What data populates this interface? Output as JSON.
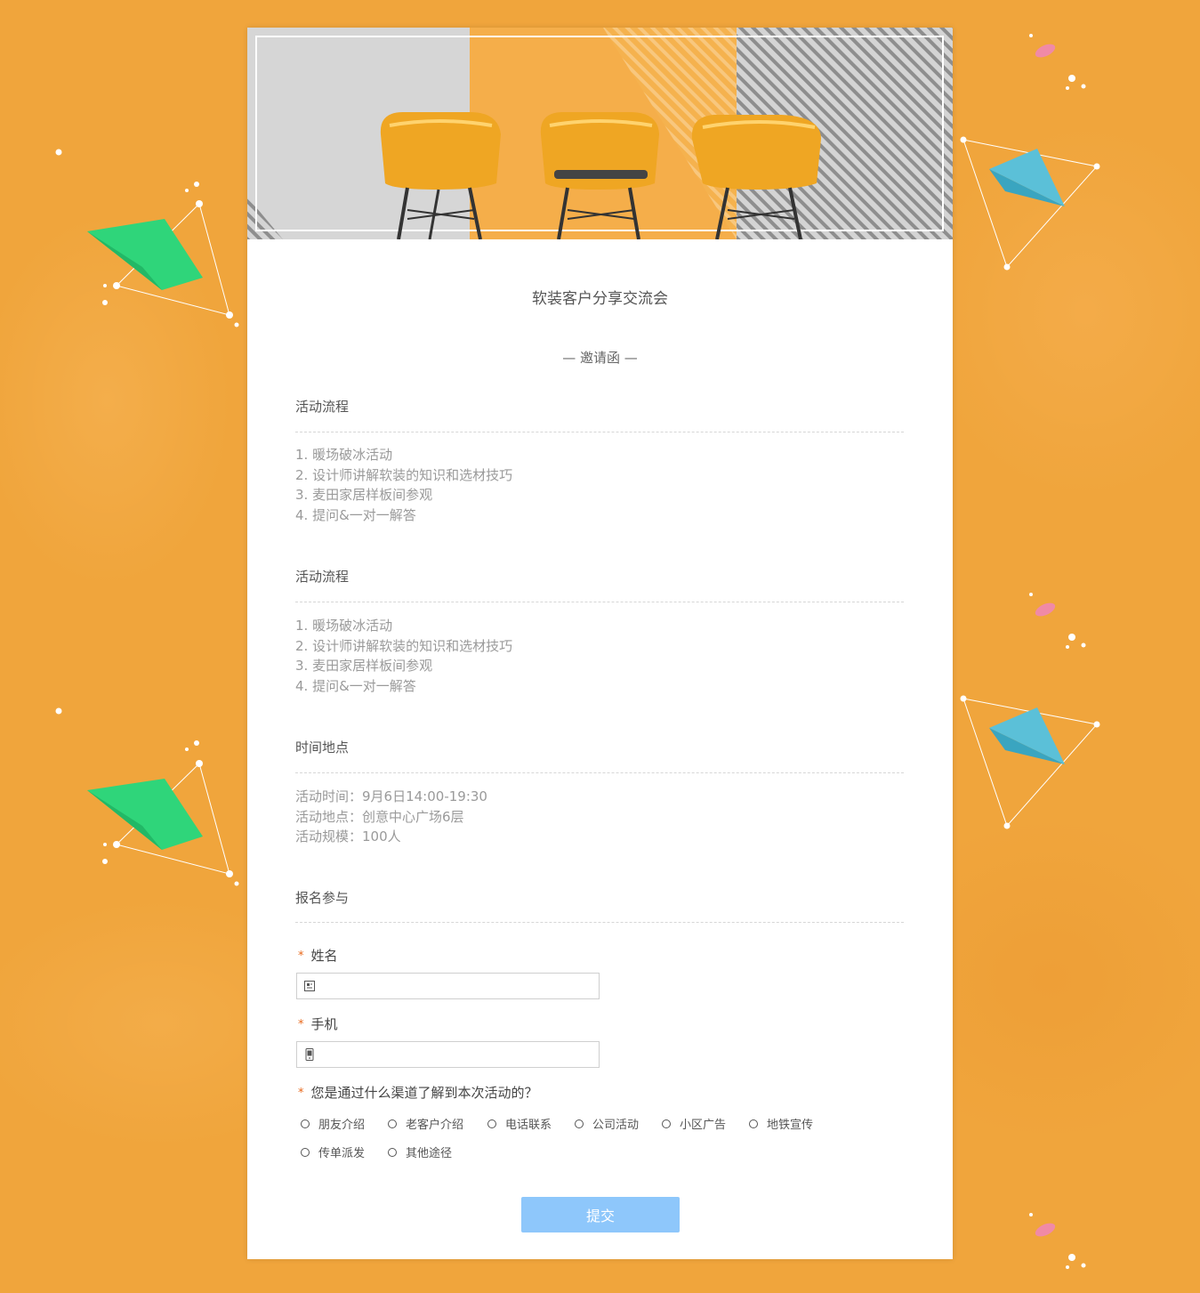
{
  "page": {
    "title": "软装客户分享交流会",
    "subtitle": "— 邀请函 —"
  },
  "sections": [
    {
      "title": "活动流程",
      "lines": [
        "1. 暖场破冰活动",
        "2. 设计师讲解软装的知识和选材技巧",
        "3. 麦田家居样板间参观",
        "4. 提问&一对一解答"
      ]
    },
    {
      "title": "活动流程",
      "lines": [
        "1. 暖场破冰活动",
        "2. 设计师讲解软装的知识和选材技巧",
        "3. 麦田家居样板间参观",
        "4. 提问&一对一解答"
      ]
    },
    {
      "title": "时间地点",
      "lines": [
        "活动时间：9月6日14:00-19:30",
        "活动地点：创意中心广场6层",
        "活动规模：100人"
      ]
    }
  ],
  "form": {
    "section_title": "报名参与",
    "required_mark": "*",
    "name_label": "姓名",
    "name_value": "",
    "phone_label": "手机",
    "phone_value": "",
    "channel_label": "您是通过什么渠道了解到本次活动的？",
    "channel_options": [
      "朋友介绍",
      "老客户介绍",
      "电话联系",
      "公司活动",
      "小区广告",
      "地铁宣传",
      "传单派发",
      "其他途径"
    ],
    "submit_label": "提交"
  },
  "colors": {
    "background": "#f0a53c",
    "required_star": "#e8681a",
    "submit_bg": "#8ec7fb",
    "green_plane": "#2fd57a",
    "blue_plane": "#5bc0d8",
    "pink_petal": "#f08aa6"
  },
  "icons": {
    "name_field": "id-card-icon",
    "phone_field": "phone-icon"
  }
}
